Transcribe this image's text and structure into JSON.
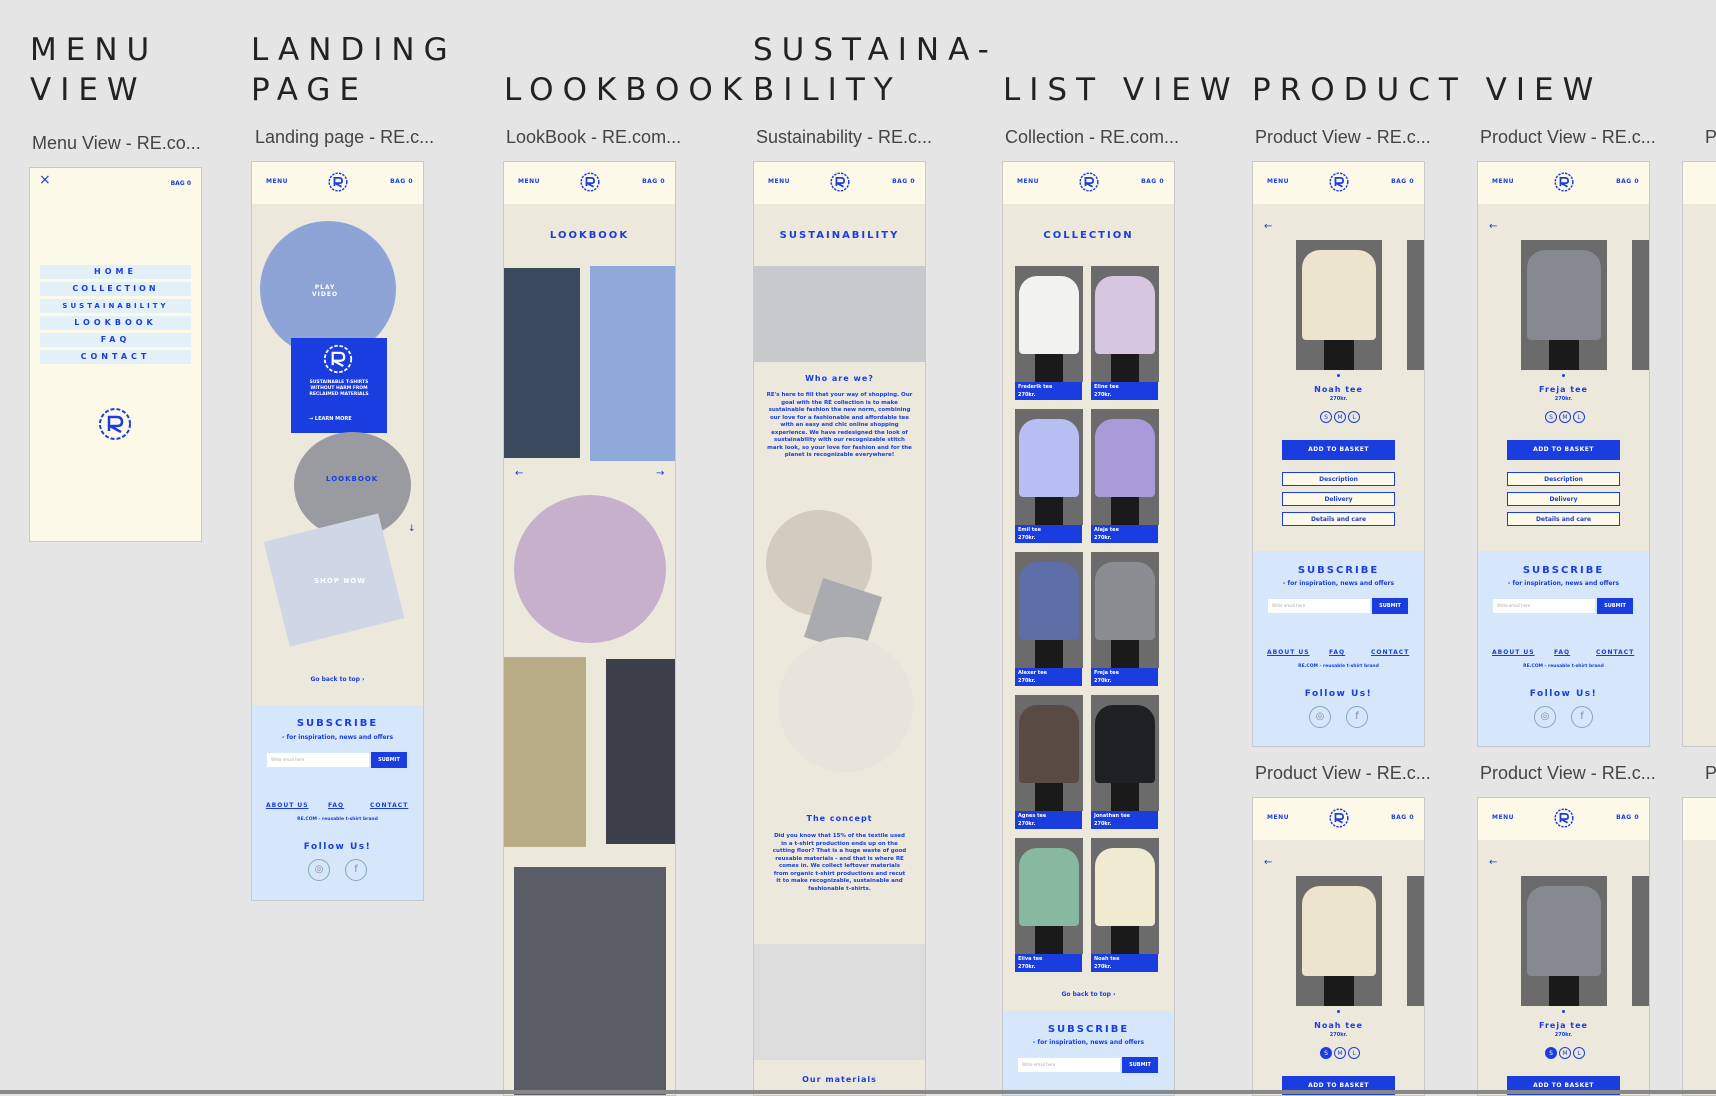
{
  "sections": {
    "menu": "MENU\nVIEW",
    "landing": "LANDING\nPAGE",
    "lookbook": "LOOKBOOK",
    "sustainability": "SUSTAINA-\nBILITY",
    "list": "LIST VIEW",
    "product": "PRODUCT VIEW"
  },
  "frame_labels": {
    "menu": "Menu View - RE.co...",
    "landing": "Landing page - RE.c...",
    "lookbook": "LookBook - RE.com...",
    "sustainability": "Sustainability - RE.c...",
    "list": "Collection - RE.com...",
    "product1": "Product View - RE.c...",
    "product2": "Product View - RE.c...",
    "product3": "Product View - RE.c...",
    "product4": "Product View - RE.c...",
    "cut1": "P",
    "cut2": "P"
  },
  "header": {
    "menu": "MENU",
    "bag": "BAG 0"
  },
  "menu_view": {
    "close": "×",
    "bag": "BAG 0",
    "items": [
      "HOME",
      "COLLECTION",
      "SUSTAINABILITY",
      "LOOKBOOK",
      "FAQ",
      "CONTACT"
    ]
  },
  "landing": {
    "play": "PLAY\nVIDEO",
    "promo": "SUSTAINABLE T-SHIRTS\nWITHOUT HARM FROM\nRECLAIMED MATERIALS",
    "learn": "→  LEARN MORE",
    "lookbook": "LOOKBOOK",
    "shop": "SHOP NOW",
    "back_top": "Go back to top ›"
  },
  "subscribe": {
    "title": "SUBSCRIBE",
    "subtitle": "- for inspiration, news and offers",
    "placeholder": "Write email here",
    "submit": "SUBMIT",
    "about": "ABOUT US",
    "faq": "FAQ",
    "contact": "CONTACT",
    "copyright": "RE.COM - reusable t-shirt brand",
    "follow": "Follow Us!",
    "instagram": "◎",
    "facebook": "f"
  },
  "lookbook": {
    "title": "LOOKBOOK",
    "prev": "←",
    "next": "→"
  },
  "sustainability": {
    "title": "SUSTAINABILITY",
    "h1": "Who are we?",
    "p1": "RE's here to fill that your way of shopping. Our goal with the RE collection is to make sustainable fashion the new norm, combining our love for a fashionable and affordable tee with an easy and chic online shopping experience. We have redesigned the look of sustainability with our recognizable stitch mark look, so your love for fashion and for the planet is recognizable everywhere!",
    "h2": "The concept",
    "p2": "Did you know that 15% of the textile used in a t-shirt production ends up on the cutting floor? That is a huge waste of good reusable materials - and that is where RE comes in. We collect leftover materials from organic t-shirt productions and recut it to make recognizable, sustainable and fashionable t-shirts.",
    "h3": "Our materials"
  },
  "collection": {
    "title": "COLLECTION",
    "items": [
      {
        "name": "Frederik tee",
        "price": "270kr.",
        "color": "#f2f2f0"
      },
      {
        "name": "Eline tee",
        "price": "270kr.",
        "color": "#d7c6e2"
      },
      {
        "name": "Emil tee",
        "price": "270kr.",
        "color": "#b7bff2"
      },
      {
        "name": "Alaja tee",
        "price": "270kr.",
        "color": "#a99ad9"
      },
      {
        "name": "Alexer tee",
        "price": "270kr.",
        "color": "#5e6ea6"
      },
      {
        "name": "Freja tee",
        "price": "270kr.",
        "color": "#8a8d92"
      },
      {
        "name": "Agnes tee",
        "price": "270kr.",
        "color": "#5a4a44"
      },
      {
        "name": "Jonathan tee",
        "price": "270kr.",
        "color": "#202124"
      },
      {
        "name": "Eliva tee",
        "price": "270kr.",
        "color": "#86b9a0"
      },
      {
        "name": "Noah tee",
        "price": "270kr.",
        "color": "#f1ead2"
      }
    ],
    "back_top": "Go back to top ›"
  },
  "products": [
    {
      "name": "Noah tee",
      "price": "270kr.",
      "color": "#ece4cc"
    },
    {
      "name": "Freja tee",
      "price": "270kr.",
      "color": "#868a90"
    },
    {
      "name": "Noah tee",
      "price": "270kr.",
      "color": "#ece4cc"
    },
    {
      "name": "Freja tee",
      "price": "270kr.",
      "color": "#868a90"
    }
  ],
  "product_ui": {
    "back": "←",
    "sizes": [
      "S",
      "M",
      "L"
    ],
    "add": "ADD TO BASKET",
    "desc": "Description",
    "delivery": "Delivery",
    "details": "Details and care"
  },
  "colors": {
    "accent": "#1a3de0",
    "header": "#fdf9e8",
    "subscribe_bg": "#d6e7fb",
    "canvas": "#e5e5e5"
  }
}
